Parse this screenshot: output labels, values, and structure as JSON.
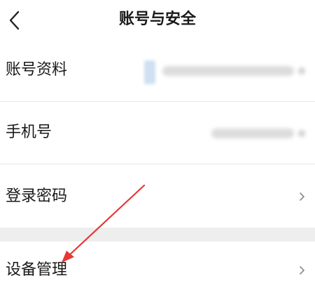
{
  "header": {
    "title": "账号与安全",
    "back_icon": "chevron-left-icon"
  },
  "rows": [
    {
      "label": "账号资料",
      "value": ""
    },
    {
      "label": "手机号",
      "value": ""
    },
    {
      "label": "登录密码",
      "chevron": "chevron-right-icon"
    },
    {
      "label": "设备管理",
      "chevron": "chevron-right-icon"
    }
  ],
  "colors": {
    "annotation_arrow": "#e53935",
    "section_gap": "#eeeeee"
  }
}
